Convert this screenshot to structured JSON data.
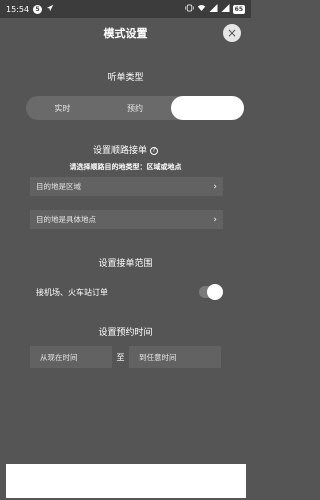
{
  "status_bar": {
    "time": "15:54",
    "badge_number": "5",
    "battery_level": "65"
  },
  "header": {
    "title": "模式设置",
    "close_label": "×"
  },
  "order_type": {
    "title": "听单类型",
    "options": [
      "实时",
      "预约",
      ""
    ],
    "active_index": 2
  },
  "route": {
    "title": "设置顺路接单",
    "help_icon": "?",
    "hint": "请选择顺路目的地类型：区域或地点",
    "field_area": "目的地是区域",
    "field_place": "目的地是具体地点",
    "chevron": "›"
  },
  "range": {
    "title": "设置接单范围",
    "airport_label": "接机场、火车站订单",
    "airport_enabled": true
  },
  "reservation_time": {
    "title": "设置预约时间",
    "from": "从现在时间",
    "separator": "至",
    "to": "到任意时间"
  },
  "colors": {
    "background": "#555555",
    "field": "#626262",
    "accent": "#ffffff"
  }
}
